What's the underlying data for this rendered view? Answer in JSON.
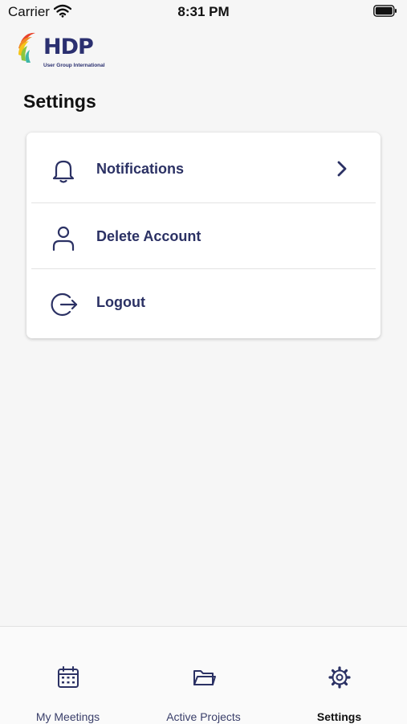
{
  "status_bar": {
    "carrier": "Carrier",
    "time": "8:31 PM"
  },
  "logo": {
    "wordmark": "HDP",
    "tagline": "User Group International"
  },
  "page": {
    "title": "Settings"
  },
  "settings": {
    "items": [
      {
        "label": "Notifications",
        "icon": "bell-icon",
        "has_chevron": true
      },
      {
        "label": "Delete Account",
        "icon": "user-icon",
        "has_chevron": false
      },
      {
        "label": "Logout",
        "icon": "logout-icon",
        "has_chevron": false
      }
    ]
  },
  "tab_bar": {
    "active": "Settings",
    "items": [
      {
        "label": "My Meetings",
        "icon": "calendar-icon"
      },
      {
        "label": "Active Projects",
        "icon": "folder-icon"
      },
      {
        "label": "Settings",
        "icon": "gear-icon"
      }
    ]
  },
  "colors": {
    "accent": "#2b3164",
    "background": "#f6f6f6",
    "card": "#ffffff"
  }
}
